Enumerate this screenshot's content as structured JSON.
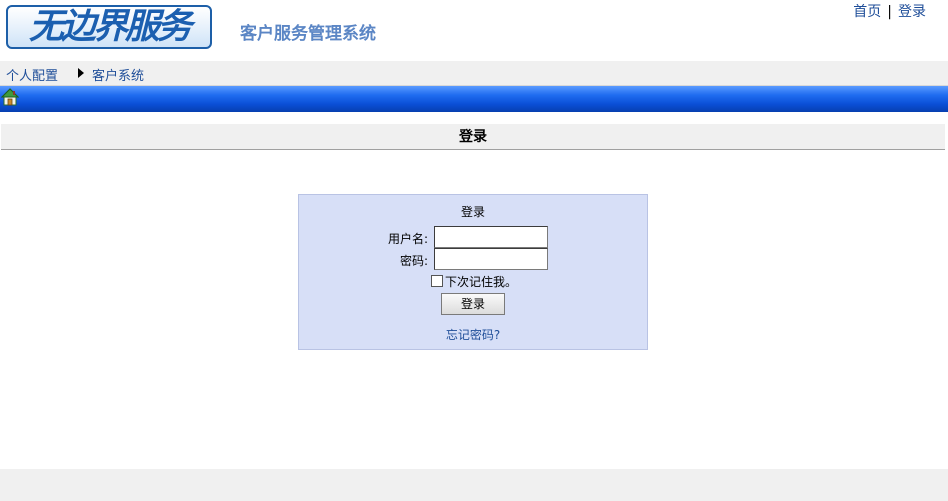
{
  "header": {
    "logo_text": "无边界服务",
    "system_title": "客户服务管理系统",
    "links": {
      "home": "首页",
      "separator": "|",
      "login": "登录"
    }
  },
  "breadcrumb": {
    "item1": "个人配置",
    "item2": "客户系统"
  },
  "navbar": {
    "icon": "home-icon",
    "color": "#0a4fd6"
  },
  "section": {
    "title": "登录"
  },
  "login": {
    "panel_title": "登录",
    "username_label": "用户名:",
    "username_value": "",
    "password_label": "密码:",
    "password_value": "",
    "remember_label": "下次记住我。",
    "remember_checked": false,
    "submit_label": "登录",
    "forgot_link": "忘记密码?",
    "panel_color": "#d7dff7"
  }
}
